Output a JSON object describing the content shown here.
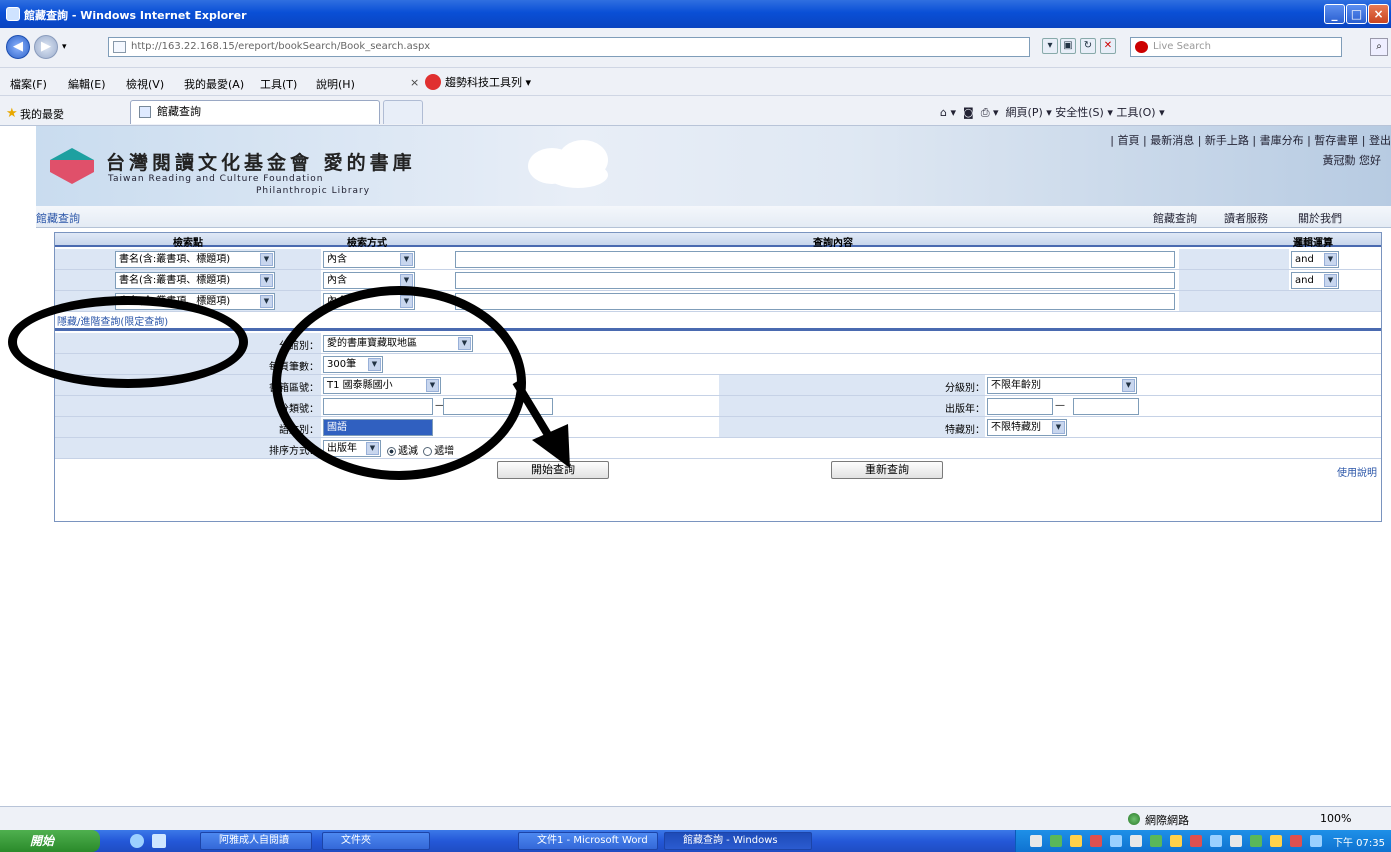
{
  "window": {
    "title": "館藏查詢 - Windows Internet Explorer",
    "controls": [
      "_",
      "□",
      "×"
    ]
  },
  "address": {
    "url": "http://163.22.168.15/ereport/bookSearch/Book_search.aspx",
    "search_placeholder": "Live Search"
  },
  "menu": {
    "items": [
      "檔案(F)",
      "編輯(E)",
      "檢視(V)",
      "我的最愛(A)",
      "工具(T)",
      "說明(H)"
    ],
    "toolbar_close": "×",
    "toolbar_brand": "趨勢科技工具列 ▾"
  },
  "favorites": {
    "label": "我的最愛",
    "tab_title": "館藏查詢",
    "command_bar": "網頁(P) ▾  安全性(S) ▾  工具(O) ▾"
  },
  "site": {
    "title": "台灣閱讀文化基金會 愛的書庫",
    "subtitle1": "Taiwan Reading and Culture Foundation",
    "subtitle2": "Philanthropic Library",
    "top_links": "| 首頁 | 最新消息 | 新手上路 | 書庫分布 | 暫存書單 | 登出",
    "username": "黃冠勳 您好"
  },
  "subnav": {
    "breadcrumb": "館藏查詢",
    "links": [
      "館藏查詢",
      "讀者服務",
      "關於我們"
    ]
  },
  "search": {
    "headers": {
      "field": "檢索點",
      "method": "檢索方式",
      "content": "查詢內容",
      "logic": "邏輯運算"
    },
    "rows": [
      {
        "field": "書名(含:叢書項、標題項)",
        "method": "內含",
        "value": "",
        "logic": "and"
      },
      {
        "field": "書名(含:叢書項、標題項)",
        "method": "內含",
        "value": "",
        "logic": "and"
      },
      {
        "field": "書名(含:叢書項、標題項)",
        "method": "內含",
        "value": "",
        "logic": ""
      }
    ],
    "advanced_link": "隱藏/進階查詢(限定查詢)"
  },
  "filters": {
    "category_label": "分館別：",
    "category_value": "愛的書庫寶藏取地區",
    "count_label": "每頁筆數：",
    "count_value": "300筆",
    "box_label": "書箱區號：",
    "box_value": "T1 國泰縣國小",
    "class_label": "分類號：",
    "class_dash": "—",
    "lang_label": "語文別：",
    "lang_value": "國語",
    "sort_label": "排序方式：",
    "sort_value": "出版年",
    "sort_opt1": "遞減",
    "sort_opt2": "遞增",
    "branch_label": "分級別：",
    "branch_value": "不限年齡別",
    "year_label": "出版年：",
    "year_dash": "—",
    "special_label": "特藏別：",
    "special_value": "不限特藏別"
  },
  "buttons": {
    "search": "開始查詢",
    "reset": "重新查詢",
    "help": "使用說明"
  },
  "status": {
    "zone": "網際網路",
    "zoom": "100%"
  },
  "taskbar": {
    "start": "開始",
    "tasks": [
      "阿雅成人自閱讀",
      "文件夾",
      "文件1 - Microsoft Word",
      "館藏查詢 - Windows"
    ],
    "clock": "下午 07:35"
  }
}
